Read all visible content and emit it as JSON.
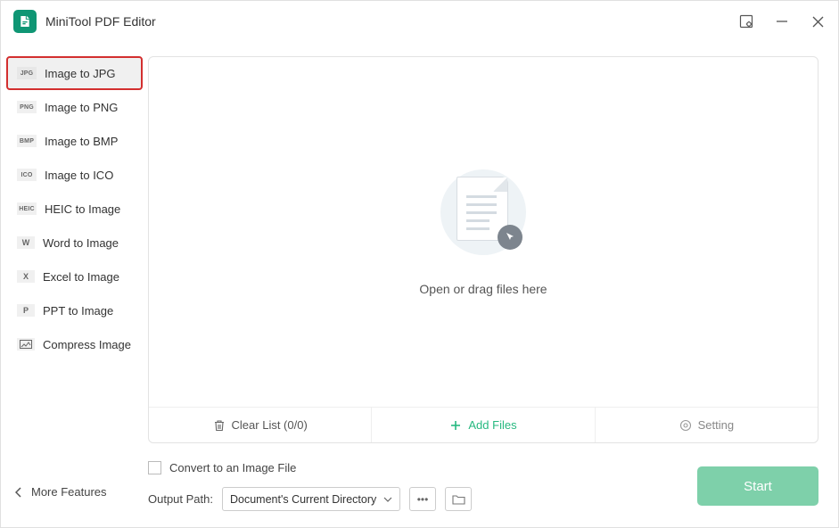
{
  "app": {
    "title": "MiniTool PDF Editor"
  },
  "sidebar": {
    "items": [
      {
        "badge": "JPG",
        "label": "Image to JPG"
      },
      {
        "badge": "PNG",
        "label": "Image to PNG"
      },
      {
        "badge": "BMP",
        "label": "Image to BMP"
      },
      {
        "badge": "ICO",
        "label": "Image to ICO"
      },
      {
        "badge": "HEIC",
        "label": "HEIC to Image"
      },
      {
        "badge": "W",
        "label": "Word to Image"
      },
      {
        "badge": "X",
        "label": "Excel to Image"
      },
      {
        "badge": "P",
        "label": "PPT to Image"
      },
      {
        "badge": "img",
        "label": "Compress Image"
      }
    ],
    "more": "More Features"
  },
  "drop": {
    "hint": "Open or drag files here"
  },
  "actions": {
    "clear": "Clear List (0/0)",
    "add": "Add Files",
    "setting": "Setting"
  },
  "footer": {
    "convert_checkbox": "Convert to an Image File",
    "output_label": "Output Path:",
    "output_value": "Document's Current Directory",
    "start": "Start"
  }
}
